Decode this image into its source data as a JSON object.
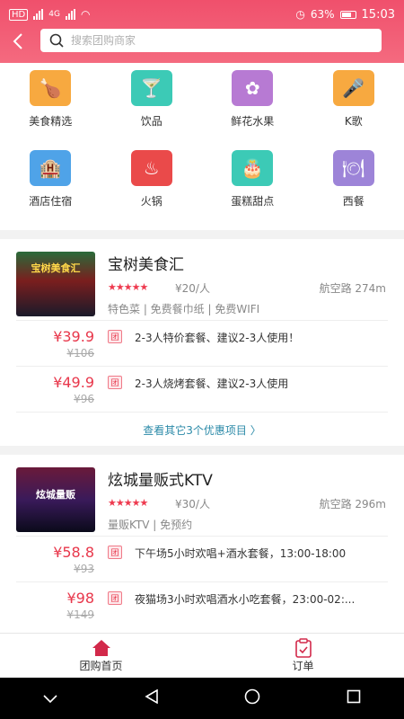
{
  "status_bar": {
    "time": "15:03",
    "battery": "63%",
    "network": "HD",
    "net_gen": "4G"
  },
  "search": {
    "placeholder": "搜索团购商家"
  },
  "categories": [
    {
      "label": "美食精选",
      "icon": "food-icon",
      "color": "#f7a940"
    },
    {
      "label": "饮品",
      "icon": "drink-icon",
      "color": "#3ccab6"
    },
    {
      "label": "鲜花水果",
      "icon": "flower-icon",
      "color": "#b77ad3"
    },
    {
      "label": "K歌",
      "icon": "microphone-icon",
      "color": "#f7a940"
    },
    {
      "label": "酒店住宿",
      "icon": "hotel-icon",
      "color": "#4fa3e8"
    },
    {
      "label": "火锅",
      "icon": "hotpot-icon",
      "color": "#ea4a4a"
    },
    {
      "label": "蛋糕甜点",
      "icon": "cake-icon",
      "color": "#3ccab6"
    },
    {
      "label": "西餐",
      "icon": "western-food-icon",
      "color": "#9d84d8"
    }
  ],
  "shops": [
    {
      "name": "宝树美食汇",
      "thumb_sign": "宝树美食汇",
      "price_per": "¥20/人",
      "distance": "航空路  274m",
      "tags": "特色菜 | 免费餐巾纸 | 免费WIFI",
      "deals": [
        {
          "price": "¥39.9",
          "old": "¥106",
          "badge": "团",
          "desc": "2-3人特价套餐、建议2-3人使用！"
        },
        {
          "price": "¥49.9",
          "old": "¥96",
          "badge": "团",
          "desc": "2-3人烧烤套餐、建议2-3人使用"
        }
      ],
      "more": "查看其它3个优惠项目 〉"
    },
    {
      "name": "炫城量贩式KTV",
      "thumb_sign": "炫城量贩",
      "price_per": "¥30/人",
      "distance": "航空路  296m",
      "tags": "量贩KTV | 免预约",
      "deals": [
        {
          "price": "¥58.8",
          "old": "¥93",
          "badge": "团",
          "desc": "下午场5小时欢唱+酒水套餐，13:00-18:00"
        },
        {
          "price": "¥98",
          "old": "¥149",
          "badge": "团",
          "desc": "夜猫场3小时欢唱酒水小吃套餐，23:00-02:..."
        }
      ]
    }
  ],
  "tabbar": [
    {
      "label": "团购首页",
      "icon": "home-icon"
    },
    {
      "label": "订单",
      "icon": "order-icon"
    }
  ],
  "colors": {
    "header": "#f0506c",
    "price": "#e8374b",
    "link": "#2b8aa8"
  }
}
